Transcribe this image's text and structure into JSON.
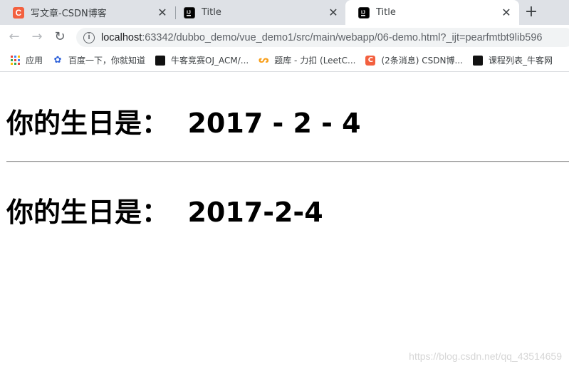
{
  "tabs": [
    {
      "title": "写文章-CSDN博客",
      "favicon": "csdn-icon",
      "active": false
    },
    {
      "title": "Title",
      "favicon": "intellij-icon",
      "active": false
    },
    {
      "title": "Title",
      "favicon": "intellij-icon",
      "active": true
    }
  ],
  "new_tab_label": "+",
  "address": {
    "host": "localhost",
    "path": ":63342/dubbo_demo/vue_demo1/src/main/webapp/06-demo.html?_ijt=pearfmtbt9lib596"
  },
  "bookmarks": [
    {
      "label": "应用",
      "icon": "apps-grid-icon"
    },
    {
      "label": "百度一下，你就知道",
      "icon": "baidu-paw-icon"
    },
    {
      "label": "牛客竞赛OJ_ACM/...",
      "icon": "nowcoder-icon"
    },
    {
      "label": "题库 - 力扣 (LeetC...",
      "icon": "leetcode-icon"
    },
    {
      "label": "(2条消息) CSDN博...",
      "icon": "csdn-icon"
    },
    {
      "label": "课程列表_牛客网",
      "icon": "nowcoder-icon"
    }
  ],
  "page": {
    "heading_formatted": "你的生日是：  2017 - 2 - 4",
    "heading_plain": "你的生日是：  2017-2-4"
  },
  "watermark": "https://blog.csdn.net/qq_43514659"
}
